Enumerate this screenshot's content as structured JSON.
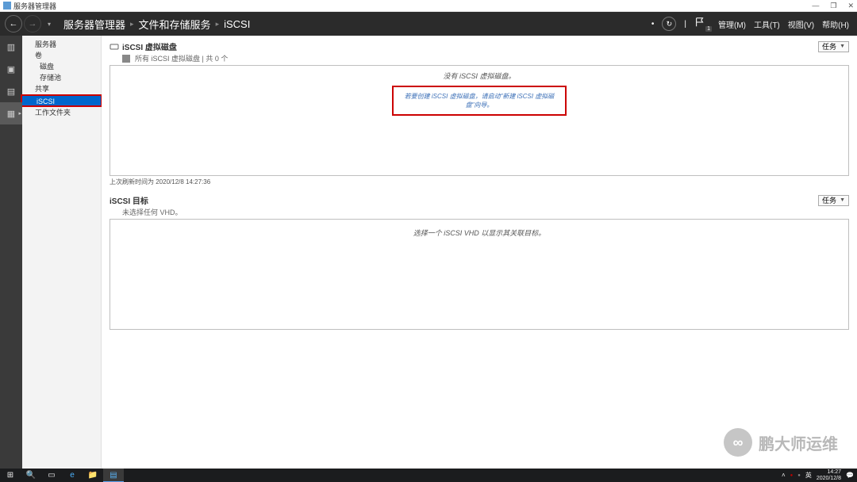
{
  "window": {
    "title": "服务器管理器",
    "minimize": "—",
    "maximize": "❐",
    "close": "✕"
  },
  "navbar": {
    "breadcrumb": [
      "服务器管理器",
      "文件和存储服务",
      "iSCSI"
    ],
    "sep": "▸",
    "refresh": "↻",
    "flag_badge": "1",
    "menus": {
      "manage": "管理(M)",
      "tools": "工具(T)",
      "view": "视图(V)",
      "help": "帮助(H)"
    },
    "pipe": "|"
  },
  "rail": [
    {
      "name": "dashboard",
      "glyph": "▥"
    },
    {
      "name": "local",
      "glyph": "▣"
    },
    {
      "name": "all",
      "glyph": "▤"
    },
    {
      "name": "file-storage",
      "glyph": "▦",
      "active": true,
      "arrow": "▸"
    }
  ],
  "sidebar": {
    "items": [
      {
        "label": "服务器",
        "lvl": 1
      },
      {
        "label": "卷",
        "lvl": 1
      },
      {
        "label": "磁盘",
        "lvl": 2
      },
      {
        "label": "存储池",
        "lvl": 2
      },
      {
        "label": "共享",
        "lvl": 1
      },
      {
        "label": "iSCSI",
        "lvl": 1,
        "active": true
      },
      {
        "label": "工作文件夹",
        "lvl": 1
      }
    ]
  },
  "panel1": {
    "title": "iSCSI 虚拟磁盘",
    "subtitle": "所有 iSCSI 虚拟磁盘 | 共 0 个",
    "tasks": "任务",
    "empty_msg": "没有 iSCSI 虚拟磁盘。",
    "hint": "若要创建 iSCSI 虚拟磁盘，请启动\"新建 iSCSI 虚拟磁盘\"向导。",
    "footer": "上次刷新时间为 2020/12/8 14:27:36"
  },
  "panel2": {
    "title": "iSCSI 目标",
    "subtitle": "未选择任何 VHD。",
    "tasks": "任务",
    "empty_msg": "选择一个 iSCSI VHD 以显示其关联目标。"
  },
  "watermark": {
    "text": "鹏大师运维",
    "icon": "∞"
  },
  "taskbar": {
    "start": "⊞",
    "items": [
      "🔍",
      "▭",
      "e",
      "📁",
      "▤"
    ],
    "tray": {
      "up": "˄",
      "ime": "英",
      "time": "14:27",
      "date": "2020/12/8",
      "notif": "💬",
      "dot1": "●",
      "dot2": "●"
    }
  }
}
